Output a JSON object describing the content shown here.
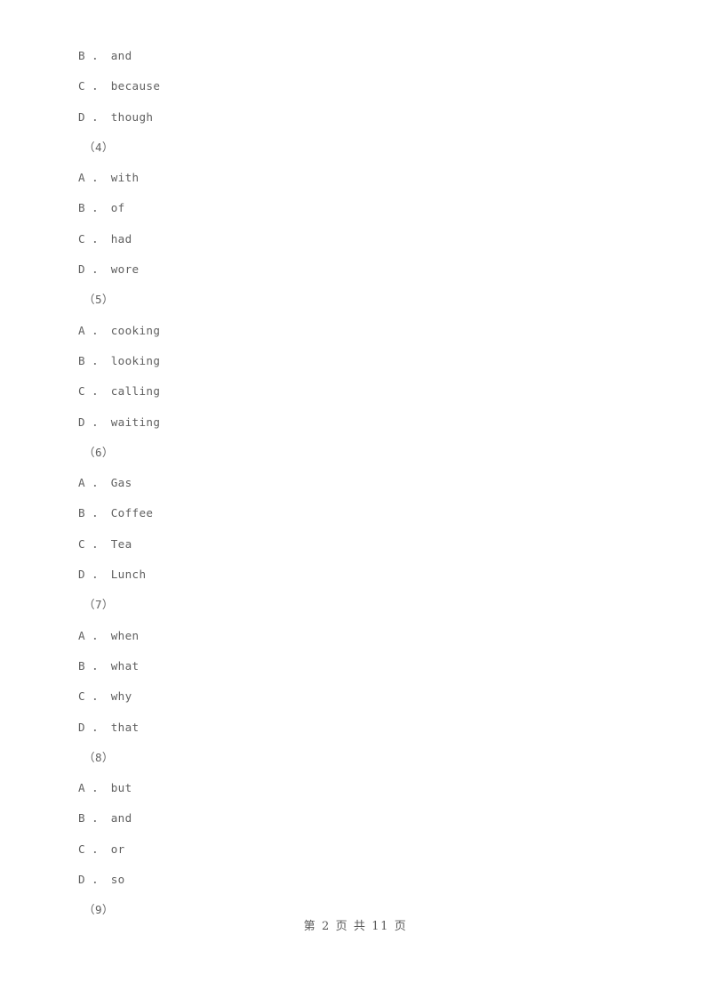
{
  "document": {
    "background_color": "#ffffff",
    "text_color": "#606060",
    "lines": [
      {
        "type": "option",
        "text": "B ． and"
      },
      {
        "type": "option",
        "text": "C ． because"
      },
      {
        "type": "option",
        "text": "D ． though"
      },
      {
        "type": "question",
        "text": "（4）"
      },
      {
        "type": "option",
        "text": "A ． with"
      },
      {
        "type": "option",
        "text": "B ． of"
      },
      {
        "type": "option",
        "text": "C ． had"
      },
      {
        "type": "option",
        "text": "D ． wore"
      },
      {
        "type": "question",
        "text": "（5）"
      },
      {
        "type": "option",
        "text": "A ． cooking"
      },
      {
        "type": "option",
        "text": "B ． looking"
      },
      {
        "type": "option",
        "text": "C ． calling"
      },
      {
        "type": "option",
        "text": "D ． waiting"
      },
      {
        "type": "question",
        "text": "（6）"
      },
      {
        "type": "option",
        "text": "A ． Gas"
      },
      {
        "type": "option",
        "text": "B ． Coffee"
      },
      {
        "type": "option",
        "text": "C ． Tea"
      },
      {
        "type": "option",
        "text": "D ． Lunch"
      },
      {
        "type": "question",
        "text": "（7）"
      },
      {
        "type": "option",
        "text": "A ． when"
      },
      {
        "type": "option",
        "text": "B ． what"
      },
      {
        "type": "option",
        "text": "C ． why"
      },
      {
        "type": "option",
        "text": "D ． that"
      },
      {
        "type": "question",
        "text": "（8）"
      },
      {
        "type": "option",
        "text": "A ． but"
      },
      {
        "type": "option",
        "text": "B ． and"
      },
      {
        "type": "option",
        "text": "C ． or"
      },
      {
        "type": "option",
        "text": "D ． so"
      },
      {
        "type": "question",
        "text": "（9）"
      }
    ]
  },
  "footer": {
    "text": "第 2 页 共 11 页",
    "current_page": "2",
    "total_pages": "11"
  }
}
